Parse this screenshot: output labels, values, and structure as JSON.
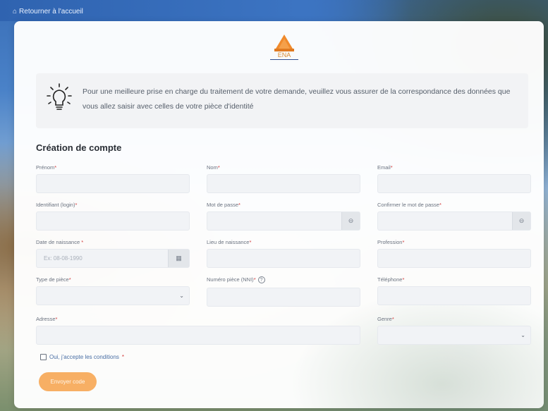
{
  "header": {
    "back_label": "Retourner à l'accueil"
  },
  "logo": {
    "text": "ENA"
  },
  "info": {
    "text": "Pour une meilleure prise en charge du traitement de votre demande, veuillez vous assurer de la correspondance des données que vous allez saisir avec celles de votre pièce d'identité"
  },
  "form": {
    "title": "Création de compte",
    "fields": {
      "prenom": {
        "label": "Prénom",
        "value": ""
      },
      "nom": {
        "label": "Nom",
        "value": ""
      },
      "email": {
        "label": "Email",
        "value": ""
      },
      "identifiant": {
        "label": "Identifiant (login)",
        "value": ""
      },
      "mot_de_passe": {
        "label": "Mot de passe",
        "value": ""
      },
      "confirmer": {
        "label": "Confirmer le mot de passe",
        "value": ""
      },
      "date_naissance": {
        "label": "Date de naissance ",
        "placeholder": "Ex: 08-08-1990"
      },
      "lieu_naissance": {
        "label": "Lieu de naissance",
        "value": ""
      },
      "profession": {
        "label": "Profession",
        "value": ""
      },
      "type_piece": {
        "label": "Type de pièce",
        "selected": ""
      },
      "numero_piece": {
        "label": "Numéro pièce (NNI)",
        "value": ""
      },
      "telephone": {
        "label": "Téléphone",
        "value": ""
      },
      "adresse": {
        "label": "Adresse",
        "value": ""
      },
      "genre": {
        "label": "Genre",
        "selected": ""
      }
    },
    "required_mark": "*",
    "terms_label": "Oui, j'accepte les conditions",
    "submit_label": "Envoyer code"
  },
  "icons": {
    "home": "home-icon",
    "bulb": "lightbulb-icon",
    "eye": "eye-icon",
    "calendar": "calendar-icon",
    "caret": "chevron-down-icon",
    "help": "question-icon"
  },
  "colors": {
    "accent": "#f7a24a",
    "required": "#d23b3b",
    "link": "#4a6fa5",
    "field_bg": "#f1f3f6"
  }
}
